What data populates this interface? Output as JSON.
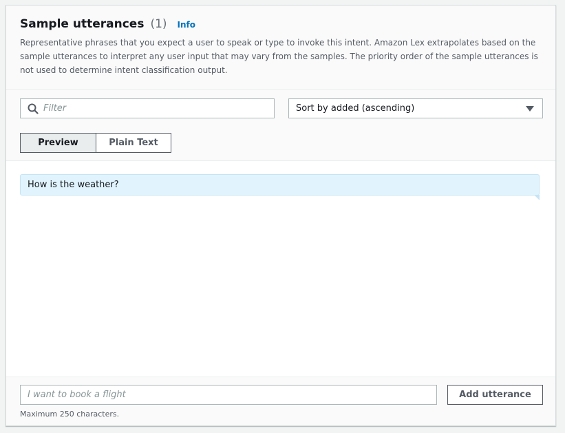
{
  "section": {
    "title": "Sample utterances",
    "count": "(1)",
    "info_label": "Info",
    "description": "Representative phrases that you expect a user to speak or type to invoke this intent. Amazon Lex extrapolates based on the sample utterances to interpret any user input that may vary from the samples. The priority order of the sample utterances is not used to determine intent classification output."
  },
  "filter": {
    "placeholder": "Filter",
    "icon": "search-icon"
  },
  "sort": {
    "selected": "Sort by added (ascending)",
    "icon": "caret-down-icon"
  },
  "view_tabs": {
    "preview": "Preview",
    "plain_text": "Plain Text",
    "active": "Preview"
  },
  "utterances": [
    {
      "text": "How is the weather?"
    }
  ],
  "new_utterance": {
    "placeholder": "I want to book a flight",
    "add_label": "Add utterance",
    "hint": "Maximum 250 characters."
  },
  "colors": {
    "accent_link": "#0073bb",
    "bubble_bg": "#e1f4fd",
    "panel_bg": "#fafafa"
  }
}
